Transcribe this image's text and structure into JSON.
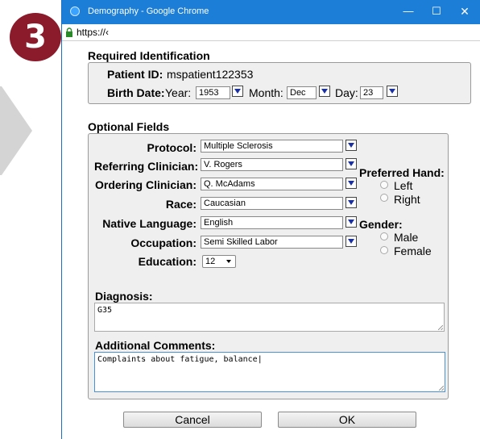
{
  "step_number": "3",
  "window": {
    "title": "Demography - Google Chrome",
    "url": "https://‹",
    "controls": {
      "minimize": "—",
      "maximize": "☐",
      "close": "✕"
    }
  },
  "required": {
    "title": "Required Identification",
    "patient_id_label": "Patient ID:",
    "patient_id": "mspatient122353",
    "birth_date_label": "Birth Date:",
    "year_label": "Year:",
    "year": "1953",
    "month_label": "Month:",
    "month": "Dec",
    "day_label": "Day:",
    "day": "23"
  },
  "optional": {
    "title": "Optional Fields",
    "protocol_label": "Protocol:",
    "protocol": "Multiple Sclerosis",
    "referring_label": "Referring Clinician:",
    "referring": "V. Rogers",
    "ordering_label": "Ordering Clinician:",
    "ordering": "Q. McAdams",
    "race_label": "Race:",
    "race": "Caucasian",
    "language_label": "Native Language:",
    "language": "English",
    "occupation_label": "Occupation:",
    "occupation": "Semi Skilled Labor",
    "education_label": "Education:",
    "education": "12",
    "hand_label": "Preferred Hand:",
    "hand_options": [
      "Left",
      "Right"
    ],
    "gender_label": "Gender:",
    "gender_options": [
      "Male",
      "Female"
    ],
    "diagnosis_label": "Diagnosis:",
    "diagnosis": "G35",
    "comments_label": "Additional Comments:",
    "comments": "Complaints about fatigue, balance"
  },
  "buttons": {
    "cancel": "Cancel",
    "ok": "OK"
  },
  "colors": {
    "badge": "#8b1a2b",
    "titlebar": "#1c7ed6",
    "panel": "#efefef",
    "dropdown_arrow": "#1a2fa0"
  }
}
